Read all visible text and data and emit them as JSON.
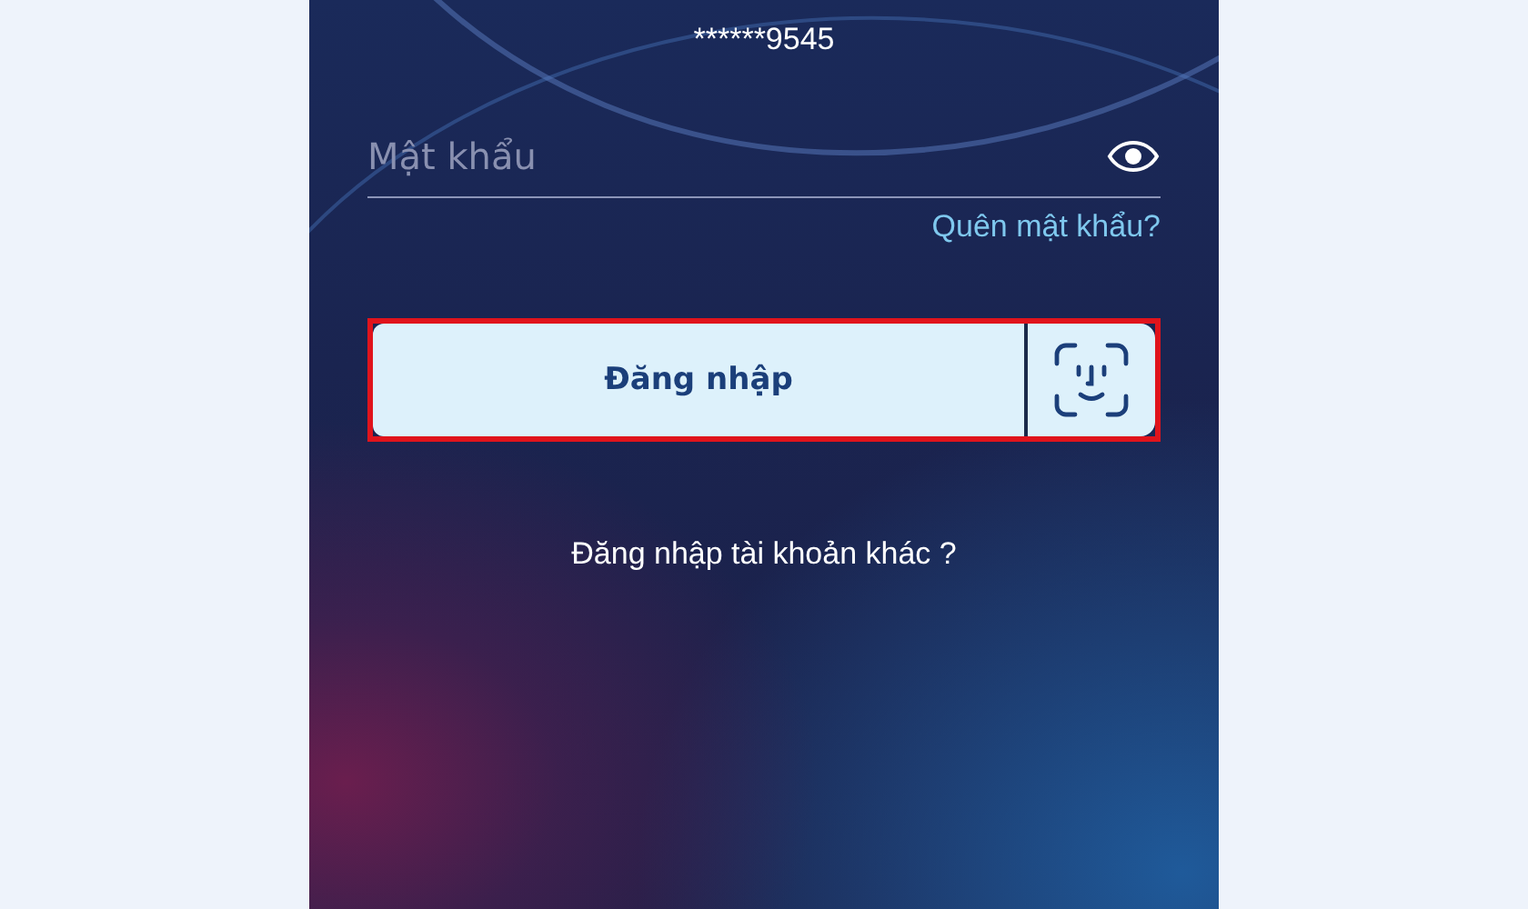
{
  "masked_account": "******9545",
  "password_field": {
    "placeholder": "Mật khẩu"
  },
  "forgot_link": "Quên mật khẩu?",
  "login_row": {
    "highlighted": true,
    "login_button": "Đăng nhập"
  },
  "other_account_link": "Đăng nhập tài khoản khác ?"
}
